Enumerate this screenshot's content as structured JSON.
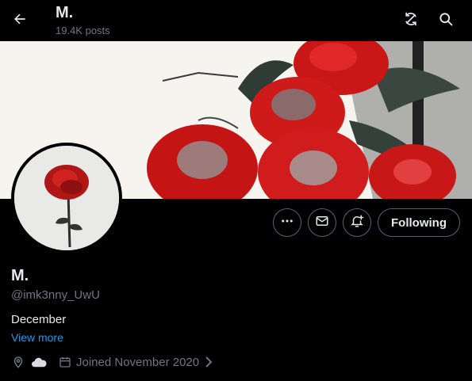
{
  "header": {
    "title": "M.",
    "posts_count": "19.4K posts"
  },
  "profile": {
    "display_name": "M.",
    "handle": "@imk3nny_UwU",
    "bio": "December",
    "view_more": "View more",
    "joined": "Joined November 2020"
  },
  "actions": {
    "following_label": "Following"
  },
  "icons": {
    "back": "arrow-left-icon",
    "refresh": "refresh-icon",
    "search": "search-icon",
    "more": "more-icon",
    "message": "envelope-icon",
    "notify": "bell-plus-icon",
    "location": "location-pin-icon",
    "weather": "cloud-icon",
    "calendar": "calendar-icon",
    "chevron": "chevron-right-icon"
  },
  "colors": {
    "background": "#000000",
    "text": "#e7e9ea",
    "muted": "#71767b",
    "link": "#1d9bf0",
    "border": "#536471",
    "rose": "#d81a1a"
  }
}
